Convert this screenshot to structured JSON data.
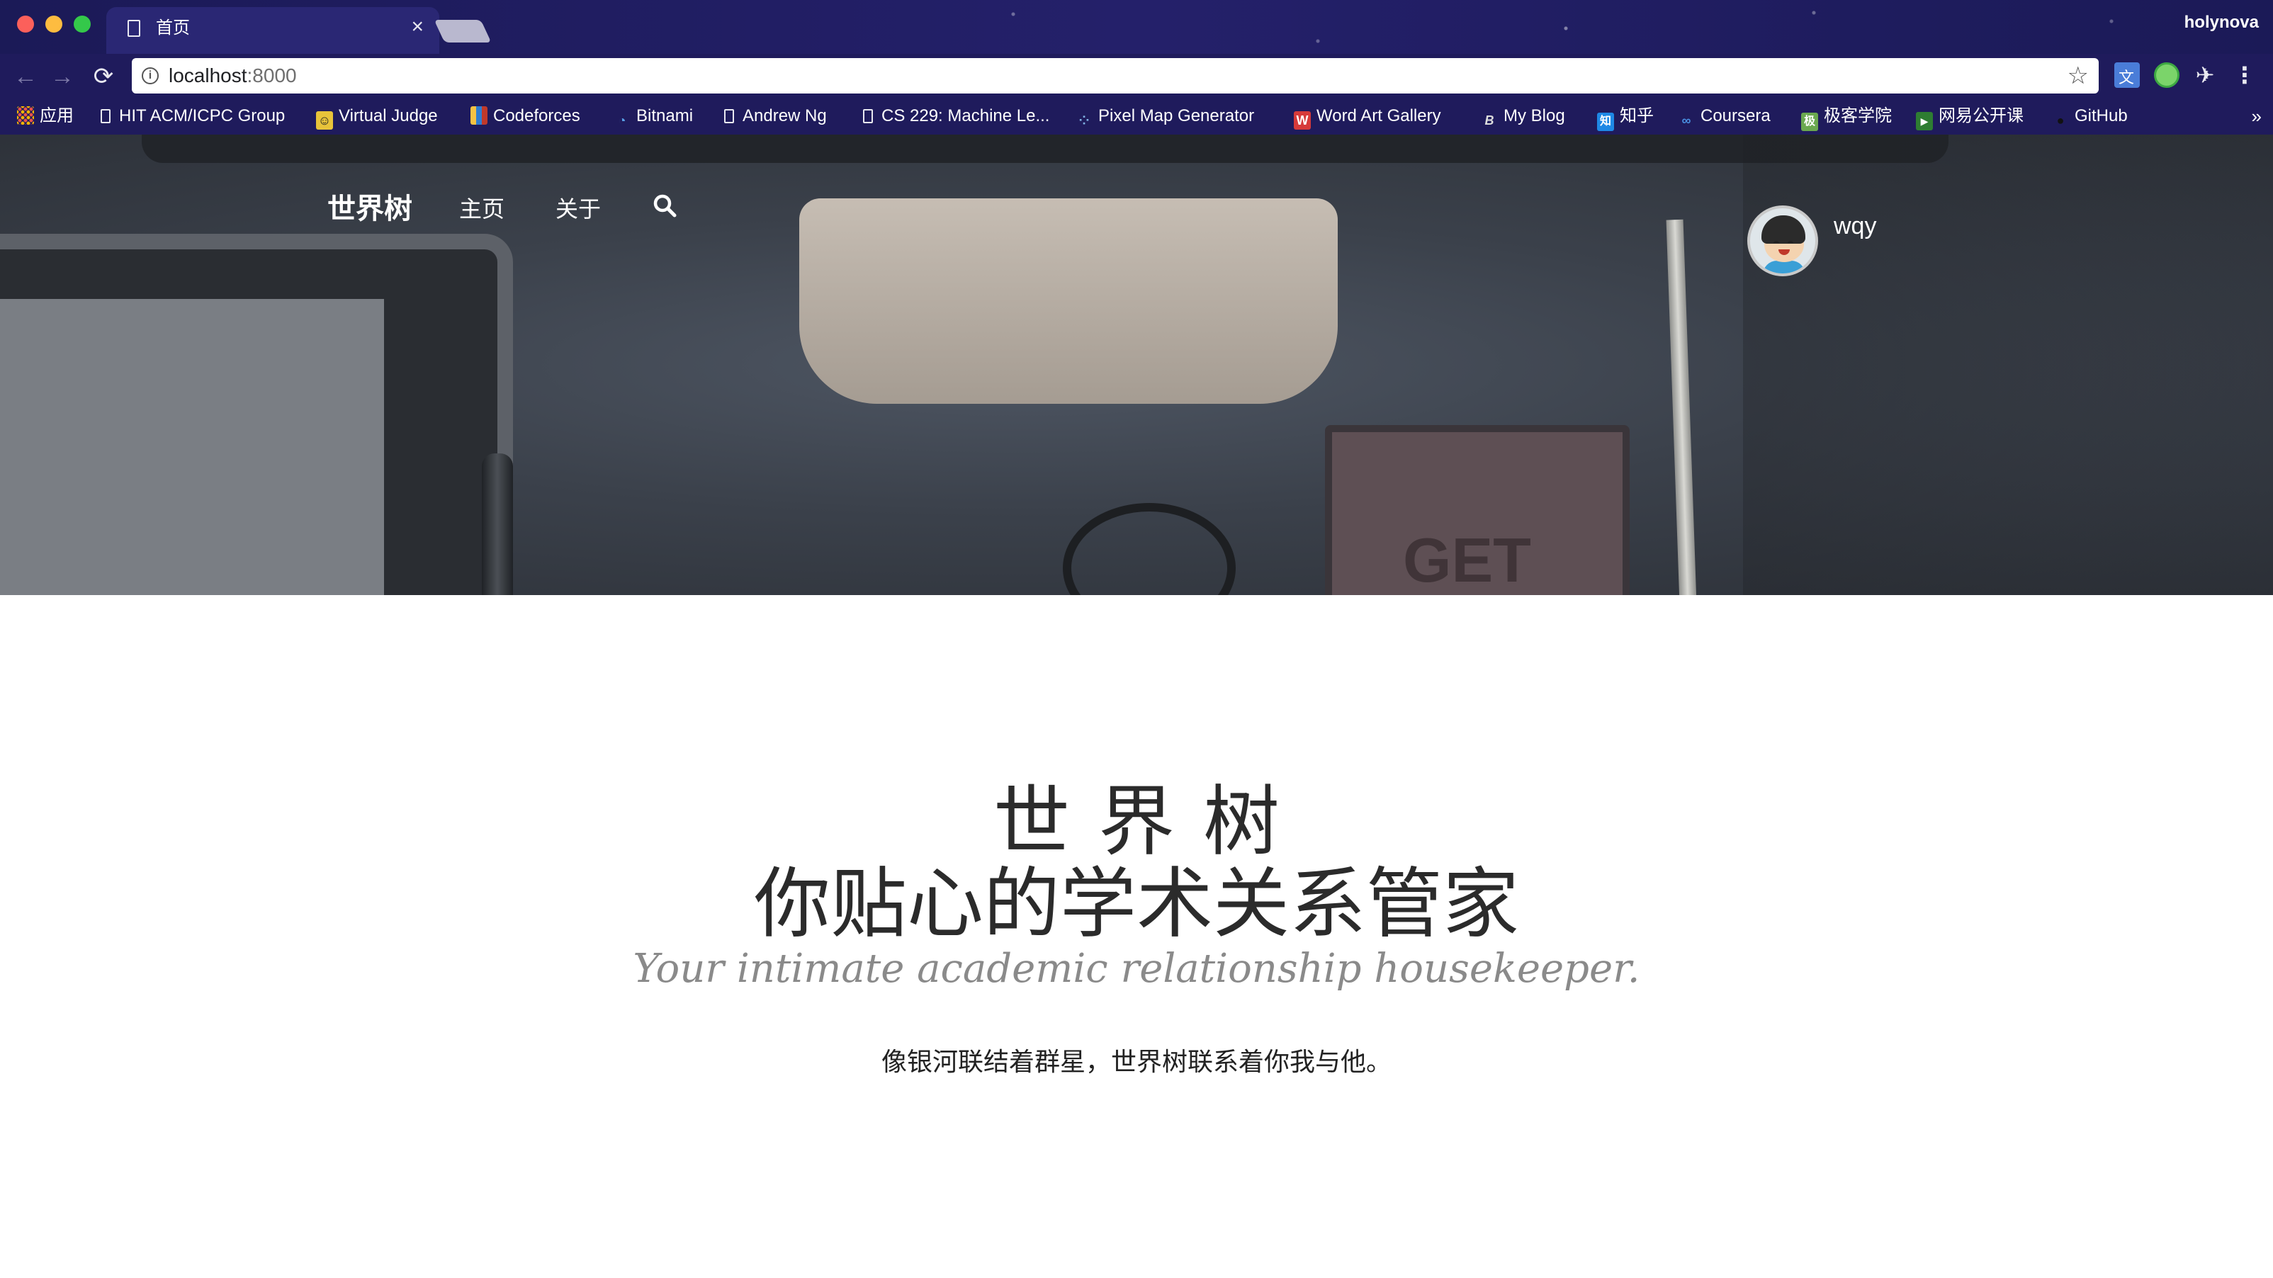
{
  "browser": {
    "tab_title": "首页",
    "tab_close": "×",
    "profile_name": "holynova",
    "url_host": "localhost",
    "url_port": ":8000",
    "bookmarks": [
      {
        "label": "应用",
        "icon": "apps-grid-icon"
      },
      {
        "label": "HIT ACM/ICPC Group",
        "icon": "page-icon"
      },
      {
        "label": "Virtual Judge",
        "icon": "vjudge-icon"
      },
      {
        "label": "Codeforces",
        "icon": "codeforces-icon"
      },
      {
        "label": "Bitnami",
        "icon": "bitnami-icon"
      },
      {
        "label": "Andrew Ng",
        "icon": "page-icon"
      },
      {
        "label": "CS 229: Machine Le...",
        "icon": "page-icon"
      },
      {
        "label": "Pixel Map Generator",
        "icon": "pixelmap-icon"
      },
      {
        "label": "Word Art Gallery",
        "icon": "wordart-icon"
      },
      {
        "label": "My Blog",
        "icon": "blog-icon"
      },
      {
        "label": "知乎",
        "icon": "zhihu-icon"
      },
      {
        "label": "Coursera",
        "icon": "coursera-icon"
      },
      {
        "label": "极客学院",
        "icon": "jike-icon"
      },
      {
        "label": "网易公开课",
        "icon": "netease-icon"
      },
      {
        "label": "GitHub",
        "icon": "github-icon"
      }
    ],
    "overflow": "»"
  },
  "site": {
    "brand": "世界树",
    "nav": {
      "home": "主页",
      "about": "关于"
    },
    "user": {
      "name": "wqy"
    },
    "hero_photo_text": "GET"
  },
  "main": {
    "title_line1": "世界树",
    "title_line2": "你贴心的学术关系管家",
    "tagline": "Your intimate academic relationship housekeeper.",
    "motto": "像银河联结着群星，世界树联系着你我与他。"
  },
  "colors": {
    "chrome_bg": "#1f1b5c",
    "title_text": "#2b2b2b",
    "tagline_text": "#8a8a8a"
  }
}
